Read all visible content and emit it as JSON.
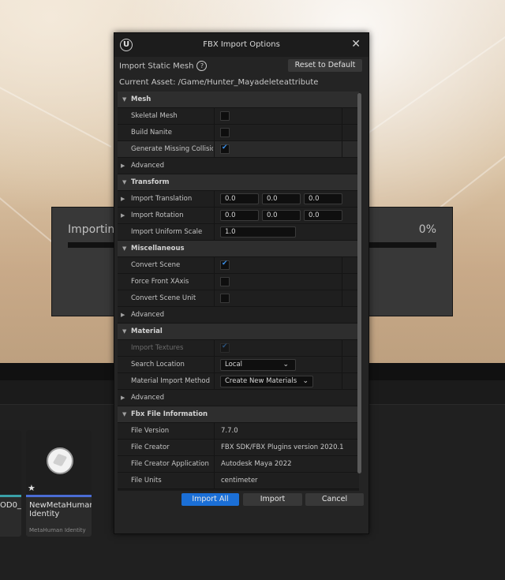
{
  "progress": {
    "label": "Importing",
    "percent_text": "0%",
    "value": 0
  },
  "content_browser": {
    "assets": [
      {
        "name": "OD0_",
        "type": ""
      },
      {
        "name": "NewMetaHuman Identity",
        "type": "MetaHuman Identity",
        "icon": "sphere-icon",
        "accent": "#4a6cd4"
      }
    ]
  },
  "dialog": {
    "title": "FBX Import Options",
    "close_glyph": "✕",
    "logo_glyph": "U",
    "header": "Import Static Mesh",
    "help_glyph": "?",
    "reset_label": "Reset to Default",
    "current_asset_label": "Current Asset:",
    "current_asset_value": "/Game/Hunter_Mayadeleteattribute",
    "sections": {
      "mesh": "Mesh",
      "transform": "Transform",
      "misc": "Miscellaneous",
      "material": "Material",
      "fbx_info": "Fbx File Information"
    },
    "mesh": {
      "skeletal_mesh": {
        "label": "Skeletal Mesh",
        "checked": false
      },
      "build_nanite": {
        "label": "Build Nanite",
        "checked": false
      },
      "generate_missing_collision": {
        "label": "Generate Missing Collision",
        "checked": true
      },
      "advanced": "Advanced"
    },
    "transform": {
      "translation": {
        "label": "Import Translation",
        "x": "0.0",
        "y": "0.0",
        "z": "0.0"
      },
      "rotation": {
        "label": "Import Rotation",
        "x": "0.0",
        "y": "0.0",
        "z": "0.0"
      },
      "uniform_scale": {
        "label": "Import Uniform Scale",
        "value": "1.0"
      }
    },
    "misc": {
      "convert_scene": {
        "label": "Convert Scene",
        "checked": true
      },
      "force_front_xaxis": {
        "label": "Force Front XAxis",
        "checked": false
      },
      "convert_scene_unit": {
        "label": "Convert Scene Unit",
        "checked": false
      },
      "advanced": "Advanced"
    },
    "material": {
      "import_textures": {
        "label": "Import Textures",
        "checked": true,
        "disabled": true
      },
      "search_location": {
        "label": "Search Location",
        "value": "Local"
      },
      "import_method": {
        "label": "Material Import Method",
        "value": "Create New Materials"
      },
      "advanced": "Advanced"
    },
    "fbx_info": {
      "file_version": {
        "label": "File Version",
        "value": "7.7.0"
      },
      "file_creator": {
        "label": "File Creator",
        "value": "FBX SDK/FBX Plugins version 2020.1"
      },
      "file_creator_app": {
        "label": "File Creator Application",
        "value": "Autodesk Maya 2022"
      },
      "file_units": {
        "label": "File Units",
        "value": "centimeter"
      }
    },
    "buttons": {
      "import_all": "Import All",
      "import": "Import",
      "cancel": "Cancel"
    },
    "colors": {
      "accent": "#1b6fd6",
      "checkmark": "#3a8fe8"
    }
  }
}
